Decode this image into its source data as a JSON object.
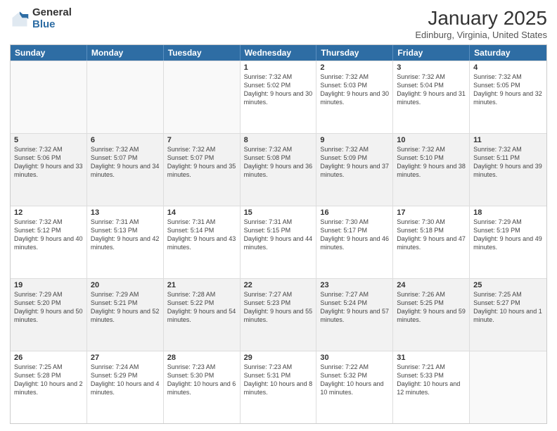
{
  "header": {
    "logo": {
      "line1": "General",
      "line2": "Blue"
    },
    "title": "January 2025",
    "location": "Edinburg, Virginia, United States"
  },
  "days_of_week": [
    "Sunday",
    "Monday",
    "Tuesday",
    "Wednesday",
    "Thursday",
    "Friday",
    "Saturday"
  ],
  "weeks": [
    [
      {
        "day": "",
        "empty": true
      },
      {
        "day": "",
        "empty": true
      },
      {
        "day": "",
        "empty": true
      },
      {
        "day": "1",
        "sunrise": "7:32 AM",
        "sunset": "5:02 PM",
        "daylight": "9 hours and 30 minutes."
      },
      {
        "day": "2",
        "sunrise": "7:32 AM",
        "sunset": "5:03 PM",
        "daylight": "9 hours and 30 minutes."
      },
      {
        "day": "3",
        "sunrise": "7:32 AM",
        "sunset": "5:04 PM",
        "daylight": "9 hours and 31 minutes."
      },
      {
        "day": "4",
        "sunrise": "7:32 AM",
        "sunset": "5:05 PM",
        "daylight": "9 hours and 32 minutes."
      }
    ],
    [
      {
        "day": "5",
        "sunrise": "7:32 AM",
        "sunset": "5:06 PM",
        "daylight": "9 hours and 33 minutes."
      },
      {
        "day": "6",
        "sunrise": "7:32 AM",
        "sunset": "5:07 PM",
        "daylight": "9 hours and 34 minutes."
      },
      {
        "day": "7",
        "sunrise": "7:32 AM",
        "sunset": "5:07 PM",
        "daylight": "9 hours and 35 minutes."
      },
      {
        "day": "8",
        "sunrise": "7:32 AM",
        "sunset": "5:08 PM",
        "daylight": "9 hours and 36 minutes."
      },
      {
        "day": "9",
        "sunrise": "7:32 AM",
        "sunset": "5:09 PM",
        "daylight": "9 hours and 37 minutes."
      },
      {
        "day": "10",
        "sunrise": "7:32 AM",
        "sunset": "5:10 PM",
        "daylight": "9 hours and 38 minutes."
      },
      {
        "day": "11",
        "sunrise": "7:32 AM",
        "sunset": "5:11 PM",
        "daylight": "9 hours and 39 minutes."
      }
    ],
    [
      {
        "day": "12",
        "sunrise": "7:32 AM",
        "sunset": "5:12 PM",
        "daylight": "9 hours and 40 minutes."
      },
      {
        "day": "13",
        "sunrise": "7:31 AM",
        "sunset": "5:13 PM",
        "daylight": "9 hours and 42 minutes."
      },
      {
        "day": "14",
        "sunrise": "7:31 AM",
        "sunset": "5:14 PM",
        "daylight": "9 hours and 43 minutes."
      },
      {
        "day": "15",
        "sunrise": "7:31 AM",
        "sunset": "5:15 PM",
        "daylight": "9 hours and 44 minutes."
      },
      {
        "day": "16",
        "sunrise": "7:30 AM",
        "sunset": "5:17 PM",
        "daylight": "9 hours and 46 minutes."
      },
      {
        "day": "17",
        "sunrise": "7:30 AM",
        "sunset": "5:18 PM",
        "daylight": "9 hours and 47 minutes."
      },
      {
        "day": "18",
        "sunrise": "7:29 AM",
        "sunset": "5:19 PM",
        "daylight": "9 hours and 49 minutes."
      }
    ],
    [
      {
        "day": "19",
        "sunrise": "7:29 AM",
        "sunset": "5:20 PM",
        "daylight": "9 hours and 50 minutes."
      },
      {
        "day": "20",
        "sunrise": "7:29 AM",
        "sunset": "5:21 PM",
        "daylight": "9 hours and 52 minutes."
      },
      {
        "day": "21",
        "sunrise": "7:28 AM",
        "sunset": "5:22 PM",
        "daylight": "9 hours and 54 minutes."
      },
      {
        "day": "22",
        "sunrise": "7:27 AM",
        "sunset": "5:23 PM",
        "daylight": "9 hours and 55 minutes."
      },
      {
        "day": "23",
        "sunrise": "7:27 AM",
        "sunset": "5:24 PM",
        "daylight": "9 hours and 57 minutes."
      },
      {
        "day": "24",
        "sunrise": "7:26 AM",
        "sunset": "5:25 PM",
        "daylight": "9 hours and 59 minutes."
      },
      {
        "day": "25",
        "sunrise": "7:25 AM",
        "sunset": "5:27 PM",
        "daylight": "10 hours and 1 minute."
      }
    ],
    [
      {
        "day": "26",
        "sunrise": "7:25 AM",
        "sunset": "5:28 PM",
        "daylight": "10 hours and 2 minutes."
      },
      {
        "day": "27",
        "sunrise": "7:24 AM",
        "sunset": "5:29 PM",
        "daylight": "10 hours and 4 minutes."
      },
      {
        "day": "28",
        "sunrise": "7:23 AM",
        "sunset": "5:30 PM",
        "daylight": "10 hours and 6 minutes."
      },
      {
        "day": "29",
        "sunrise": "7:23 AM",
        "sunset": "5:31 PM",
        "daylight": "10 hours and 8 minutes."
      },
      {
        "day": "30",
        "sunrise": "7:22 AM",
        "sunset": "5:32 PM",
        "daylight": "10 hours and 10 minutes."
      },
      {
        "day": "31",
        "sunrise": "7:21 AM",
        "sunset": "5:33 PM",
        "daylight": "10 hours and 12 minutes."
      },
      {
        "day": "",
        "empty": true
      }
    ]
  ]
}
